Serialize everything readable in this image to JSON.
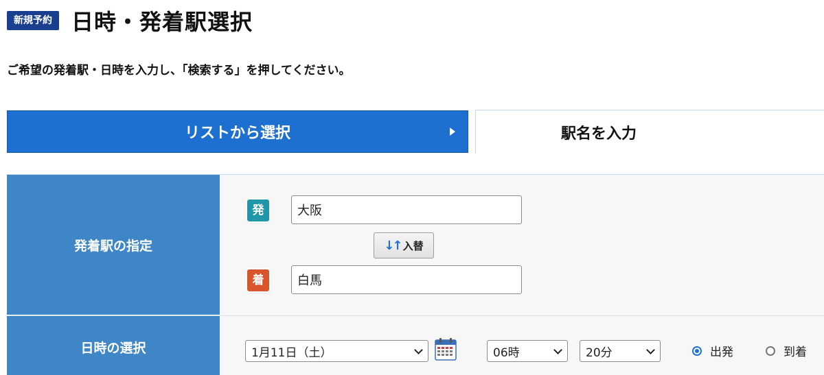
{
  "header": {
    "badge": "新規予約",
    "title": "日時・発着駅選択"
  },
  "instruction": "ご希望の発着駅・日時を入力し、「検索する」を押してください。",
  "tabs": {
    "list_label": "リストから選択",
    "input_label": "駅名を入力"
  },
  "station": {
    "label": "発着駅の指定",
    "from_icon": "発",
    "to_icon": "着",
    "from_value": "大阪",
    "to_value": "白馬",
    "swap_label": "入替"
  },
  "datetime": {
    "label": "日時の選択",
    "date_value": "1月11日（土）",
    "hour_value": "06時",
    "minute_value": "20分",
    "departure_label": "出発",
    "arrival_label": "到着",
    "selected": "departure"
  },
  "colors": {
    "badge": "#1a3f8f",
    "tab_active": "#1d6fd0",
    "row_label": "#3e86c6",
    "from_icon": "#1f97a8",
    "to_icon": "#d9552c"
  },
  "icons": {
    "tab_arrow": "triangle-right-icon",
    "swap": "swap-arrows-icon",
    "calendar": "calendar-icon"
  }
}
